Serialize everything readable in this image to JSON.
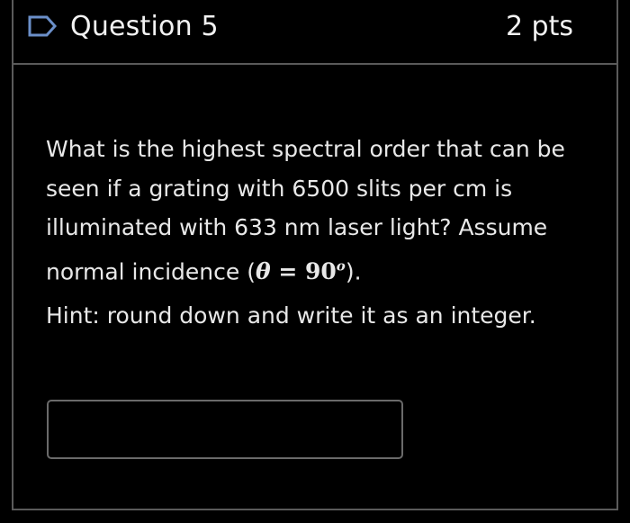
{
  "question": {
    "title": "Question 5",
    "points": "2 pts",
    "text_before_math": "What is the highest spectral order that can be seen if a grating with 6500 slits per cm is illuminated with 633 nm laser light? Assume normal incidence (",
    "math": {
      "theta": "θ",
      "equals": " = ",
      "value": "90",
      "superscript": "o"
    },
    "text_after_math": ").",
    "hint": "Hint: round down and write it as an integer.",
    "answer_value": ""
  },
  "colors": {
    "background": "#000000",
    "border": "#5a5a5a",
    "text": "#e8e8e8",
    "flag": "#6b8fc9"
  },
  "icons": {
    "flag": "bookmark-flag-icon"
  }
}
